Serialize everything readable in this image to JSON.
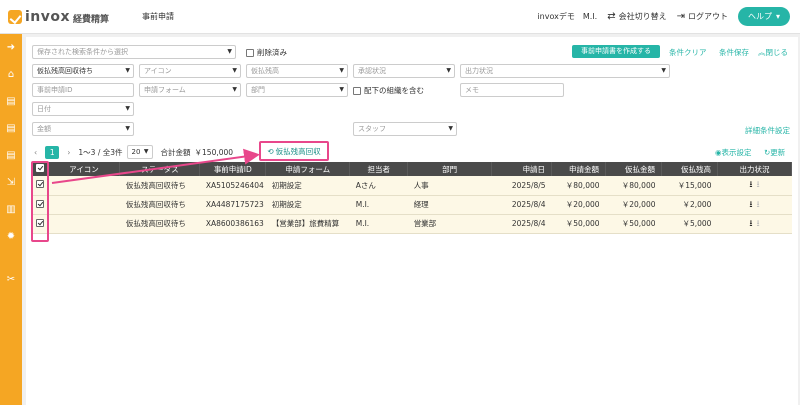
{
  "header": {
    "logo_text": "invox",
    "logo_sub": "経費精算",
    "page_title": "事前申請",
    "user": "invoxデモ　M.I.",
    "switch_company": "会社切り替え",
    "logout": "ログアウト",
    "help": "ヘルプ"
  },
  "filters": {
    "saved_placeholder": "保存された検索条件から選択",
    "deleted_label": "削除済み",
    "create_button": "事前申請書を作成する",
    "clear": "条件クリア",
    "save": "条件保存",
    "close": "閉じる",
    "status_value": "仮払残高回収待ち",
    "icon": "アイコン",
    "advance_balance": "仮払残高",
    "approval_status": "承認状況",
    "output_status": "出力状況",
    "request_id": "事前申請ID",
    "form": "申請フォーム",
    "department": "部門",
    "subordinate_label": "配下の組織を含む",
    "memo": "メモ",
    "date": "日付",
    "amount": "金額",
    "staff": "スタッフ",
    "detail_settings": "詳細条件設定"
  },
  "toolbar": {
    "page": "1",
    "range": "1〜3 / 全3件",
    "per_page": "20",
    "total_label": "合計金額",
    "total_value": "￥150,000",
    "collect_button": "仮払残高回収",
    "display_settings": "表示設定",
    "refresh": "更新"
  },
  "table": {
    "headers": [
      "",
      "アイコン",
      "ステータス",
      "事前申請ID",
      "申請フォーム",
      "担当者",
      "部門",
      "申請日",
      "申請金額",
      "仮払金額",
      "仮払残高",
      "出力状況"
    ],
    "rows": [
      {
        "status": "仮払残高回収待ち",
        "id": "XA5105246404",
        "form": "初期設定",
        "person": "Aさん",
        "dept": "人事",
        "date": "2025/8/5",
        "amount": "￥80,000",
        "advance": "￥80,000",
        "balance": "￥15,000"
      },
      {
        "status": "仮払残高回収待ち",
        "id": "XA4487175723",
        "form": "初期設定",
        "person": "M.I.",
        "dept": "経理",
        "date": "2025/8/4",
        "amount": "￥20,000",
        "advance": "￥20,000",
        "balance": "￥2,000"
      },
      {
        "status": "仮払残高回収待ち",
        "id": "XA8600386163",
        "form": "【営業部】旅費精算",
        "person": "M.I.",
        "dept": "営業部",
        "date": "2025/8/4",
        "amount": "￥50,000",
        "advance": "￥50,000",
        "balance": "￥5,000"
      }
    ]
  },
  "colors": {
    "accent": "#26b5a7",
    "nav": "#f5a623",
    "highlight": "#e8478b"
  }
}
